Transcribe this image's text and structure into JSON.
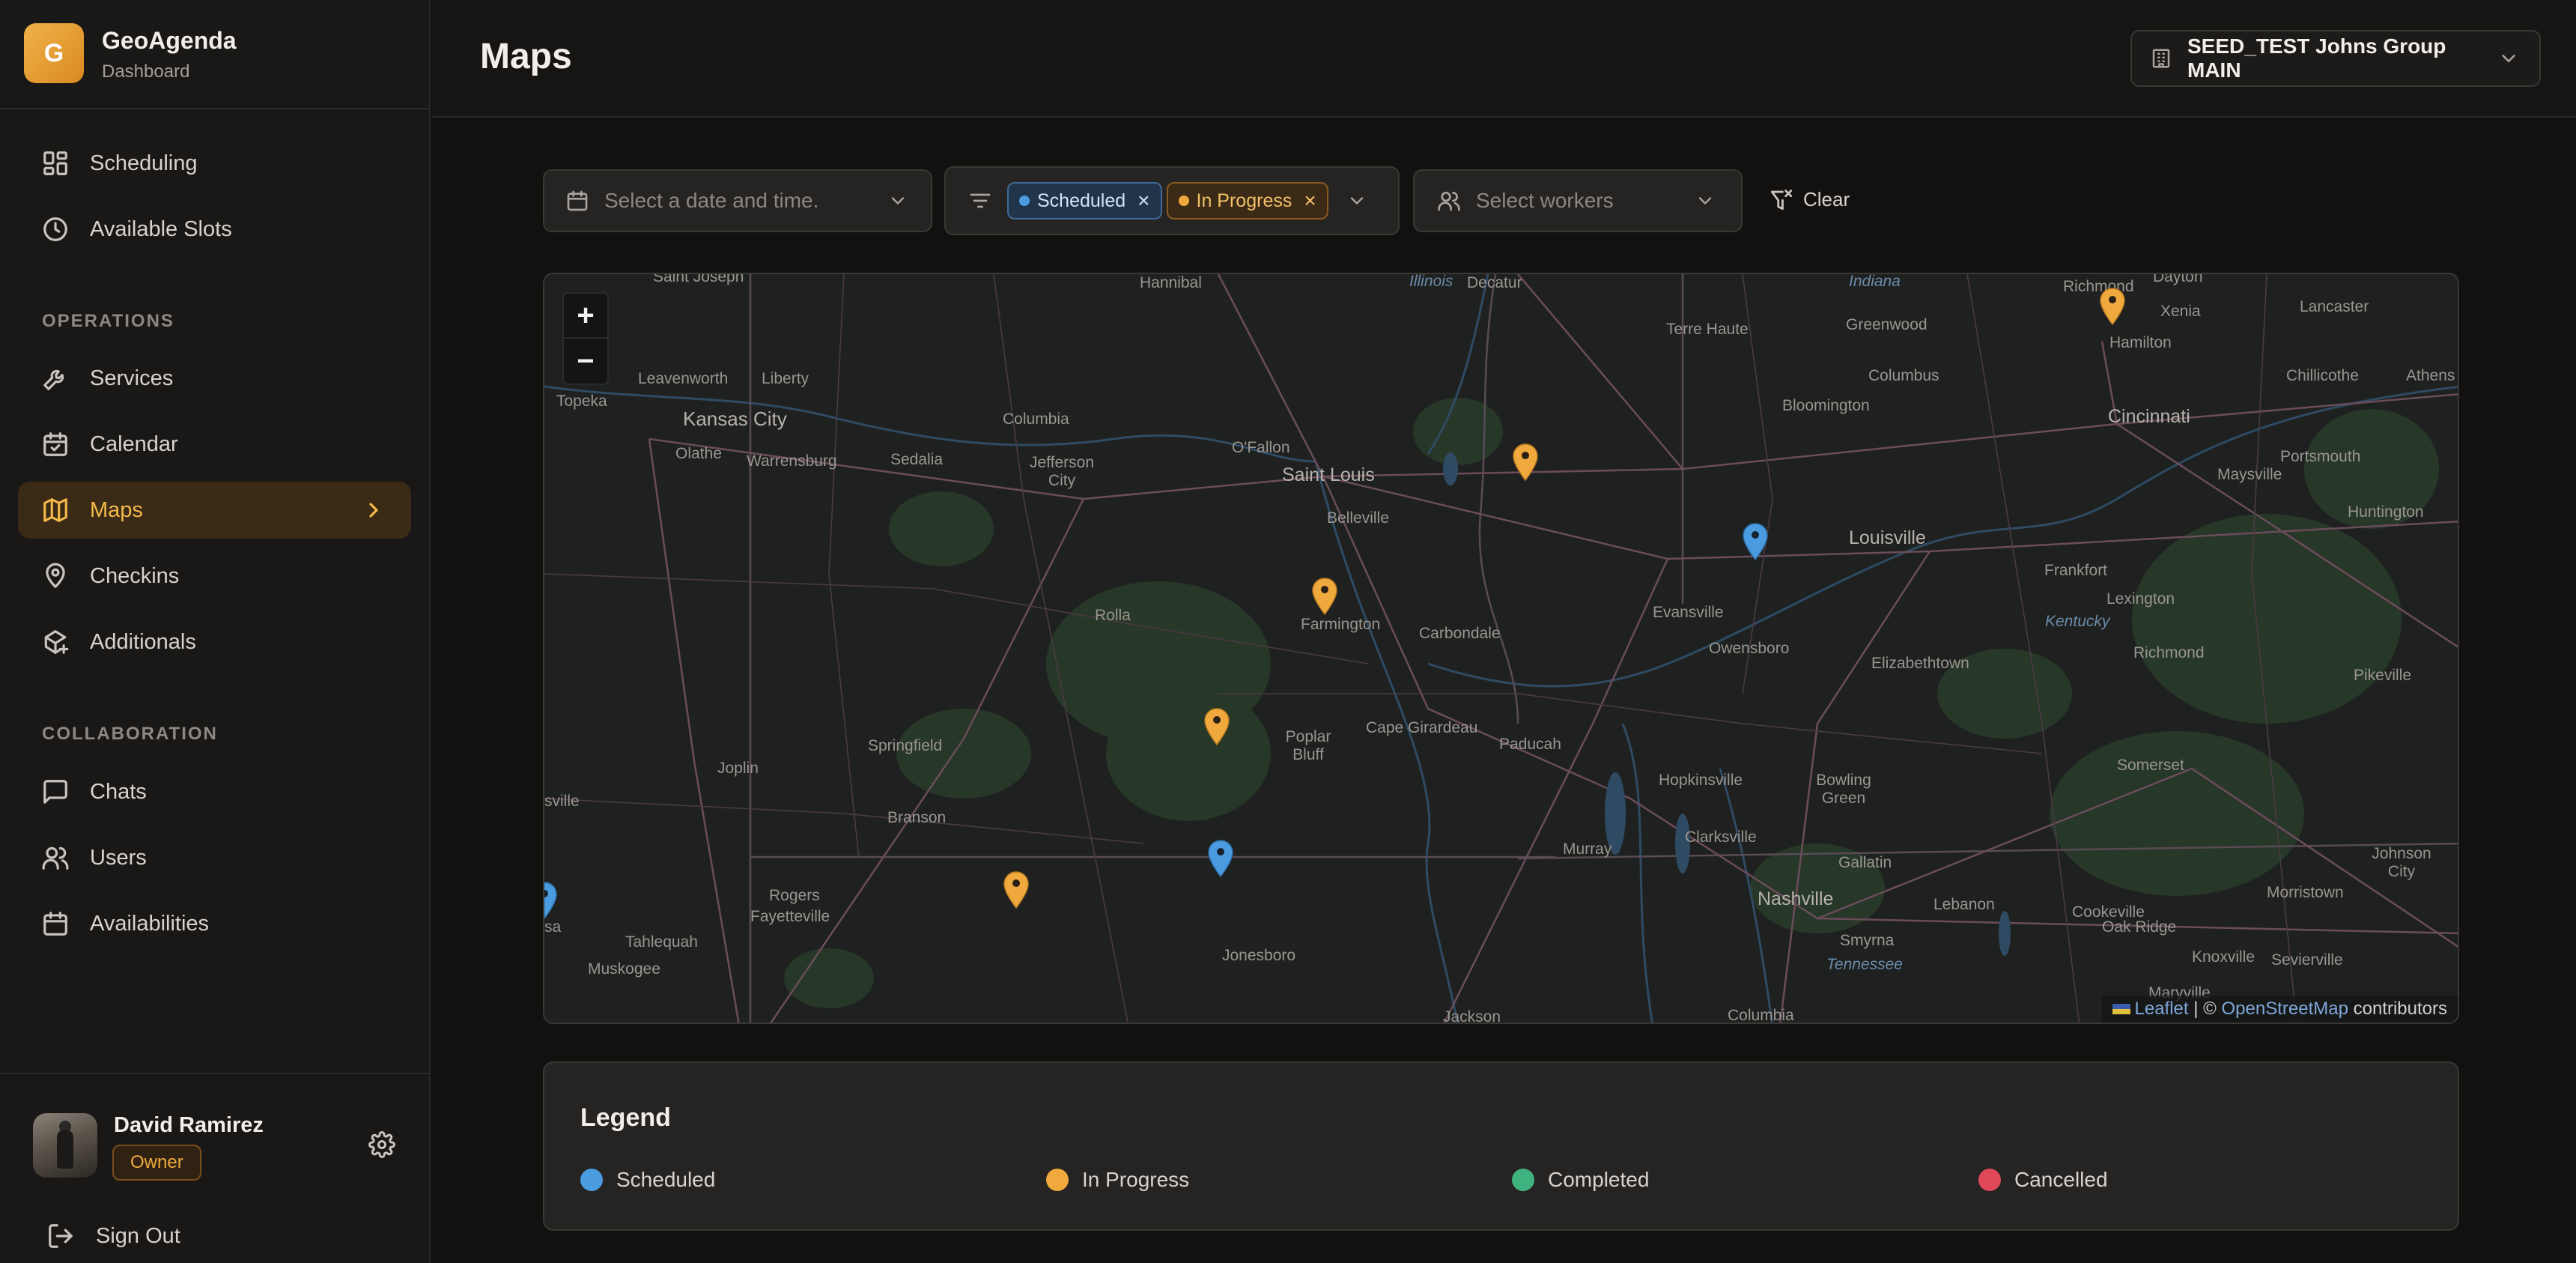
{
  "brand": {
    "logo_letter": "G",
    "name": "GeoAgenda",
    "subtitle": "Dashboard"
  },
  "sidebar": {
    "top_items": [
      {
        "label": "Scheduling",
        "icon": "grid-icon"
      },
      {
        "label": "Available Slots",
        "icon": "clock-icon"
      }
    ],
    "operations_label": "OPERATIONS",
    "operations_items": [
      {
        "label": "Services",
        "icon": "wrench-icon"
      },
      {
        "label": "Calendar",
        "icon": "calendar-check-icon"
      },
      {
        "label": "Maps",
        "icon": "map-icon",
        "active": true
      },
      {
        "label": "Checkins",
        "icon": "map-pin-icon"
      },
      {
        "label": "Additionals",
        "icon": "package-plus-icon"
      }
    ],
    "collaboration_label": "COLLABORATION",
    "collaboration_items": [
      {
        "label": "Chats",
        "icon": "message-square-icon"
      },
      {
        "label": "Users",
        "icon": "users-icon"
      },
      {
        "label": "Availabilities",
        "icon": "calendar-icon"
      }
    ]
  },
  "user": {
    "name": "David Ramirez",
    "role": "Owner",
    "signout_label": "Sign Out"
  },
  "header": {
    "title": "Maps",
    "org_select": "SEED_TEST Johns Group MAIN"
  },
  "filters": {
    "date_placeholder": "Select a date and time.",
    "status_chips": [
      {
        "label": "Scheduled",
        "color": "#4a9be0"
      },
      {
        "label": "In Progress",
        "color": "#f0a93d"
      }
    ],
    "workers_placeholder": "Select workers",
    "clear_label": "Clear"
  },
  "map": {
    "zoom_in": "+",
    "zoom_out": "−",
    "attribution": {
      "leaflet": "Leaflet",
      "sep": " | © ",
      "osm": "OpenStreetMap",
      "suffix": " contributors"
    },
    "cities": [
      "Saint Joseph",
      "Hannibal",
      "Illinois",
      "Decatur",
      "Indiana",
      "Richmond",
      "Dayton",
      "Lancaster",
      "Xenia",
      "Hamilton",
      "Terre Haute",
      "Greenwood",
      "Leavenworth",
      "Liberty",
      "Kansas City",
      "Topeka",
      "Olathe",
      "Warrensburg",
      "Sedalia",
      "Columbia",
      "Jefferson City",
      "O'Fallon",
      "Saint Louis",
      "Belleville",
      "Bloomington",
      "Columbus",
      "Cincinnati",
      "Chillicothe",
      "Athens",
      "Portsmouth",
      "Maysville",
      "Huntington",
      "Louisville",
      "Frankfort",
      "Lexington",
      "Kentucky",
      "Rolla",
      "Farmington",
      "Carbondale",
      "Evansville",
      "Owensboro",
      "Elizabethtown",
      "Richmond",
      "Pikeville",
      "Springfield",
      "Cape Girardeau",
      "Paducah",
      "Hopkinsville",
      "Bowling Green",
      "Somerset",
      "Joplin",
      "Branson",
      "Poplar Bluff",
      "Murray",
      "Clarksville",
      "Gallatin",
      "Johnson City",
      "Rogers",
      "Fayetteville",
      "Tahlequah",
      "Muskogee",
      "Jonesboro",
      "Nashville",
      "Lebanon",
      "Cookeville",
      "Morristown",
      "Oak Ridge",
      "Knoxville",
      "Sevierville",
      "Smyrna",
      "Tennessee",
      "Maryville",
      "Jackson",
      "Columbia",
      "sville",
      "sa"
    ],
    "markers": [
      {
        "status": "In Progress",
        "color": "#f0a93d"
      },
      {
        "status": "In Progress",
        "color": "#f0a93d"
      },
      {
        "status": "Scheduled",
        "color": "#4a9be0"
      },
      {
        "status": "In Progress",
        "color": "#f0a93d"
      },
      {
        "status": "In Progress",
        "color": "#f0a93d"
      },
      {
        "status": "Scheduled",
        "color": "#4a9be0"
      },
      {
        "status": "In Progress",
        "color": "#f0a93d"
      },
      {
        "status": "Scheduled",
        "color": "#4a9be0"
      }
    ]
  },
  "legend": {
    "title": "Legend",
    "items": [
      {
        "label": "Scheduled",
        "color": "#4a9be0"
      },
      {
        "label": "In Progress",
        "color": "#f0a93d"
      },
      {
        "label": "Completed",
        "color": "#3fb27f"
      },
      {
        "label": "Cancelled",
        "color": "#e0485a"
      }
    ]
  }
}
